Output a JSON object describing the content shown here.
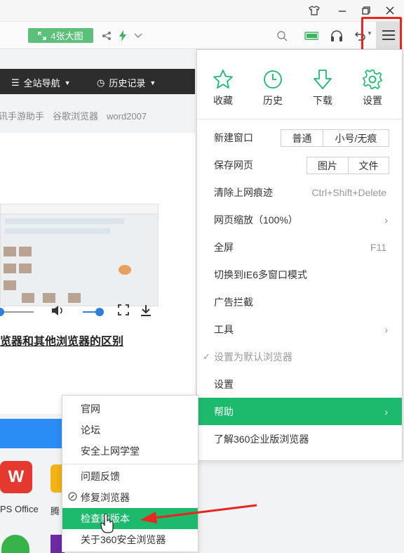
{
  "toolbar": {
    "big_image_label": "4张大图"
  },
  "navbar": {
    "site_nav": "全站导航",
    "history": "历史记录"
  },
  "links": [
    "讯手游助手",
    "谷歌浏览器",
    "word2007"
  ],
  "article": {
    "title": "览器和其他浏览器的区别"
  },
  "apps": {
    "wps_label": "PS Office",
    "tencent_label": "腾"
  },
  "menu": {
    "quick": [
      {
        "label": "收藏",
        "icon": "star-icon"
      },
      {
        "label": "历史",
        "icon": "clock-icon"
      },
      {
        "label": "下载",
        "icon": "download-arrow-icon"
      },
      {
        "label": "设置",
        "icon": "gear-icon"
      }
    ],
    "new_window": {
      "label": "新建窗口",
      "normal": "普通",
      "incognito": "小号/无痕"
    },
    "save_page": {
      "label": "保存网页",
      "image": "图片",
      "file": "文件"
    },
    "clear_traces": {
      "label": "清除上网痕迹",
      "shortcut": "Ctrl+Shift+Delete"
    },
    "zoom": {
      "label": "网页缩放（100%）"
    },
    "fullscreen": {
      "label": "全屏",
      "shortcut": "F11"
    },
    "ie6_mode": "切换到IE6多窗口模式",
    "ad_block": "广告拦截",
    "tools": "工具",
    "set_default": "设置为默认浏览器",
    "settings": "设置",
    "help": "帮助",
    "enterprise": "了解360企业版浏览器"
  },
  "submenu": {
    "items_top": [
      "官网",
      "论坛",
      "安全上网学堂"
    ],
    "feedback": "问题反馈",
    "repair": "修复浏览器",
    "check_update": "检查新版本",
    "about": "关于360安全浏览器"
  },
  "colors": {
    "accent_green": "#1dba6e",
    "highlight_red": "#e8261d",
    "navbar_dark": "#2d2d2d"
  }
}
